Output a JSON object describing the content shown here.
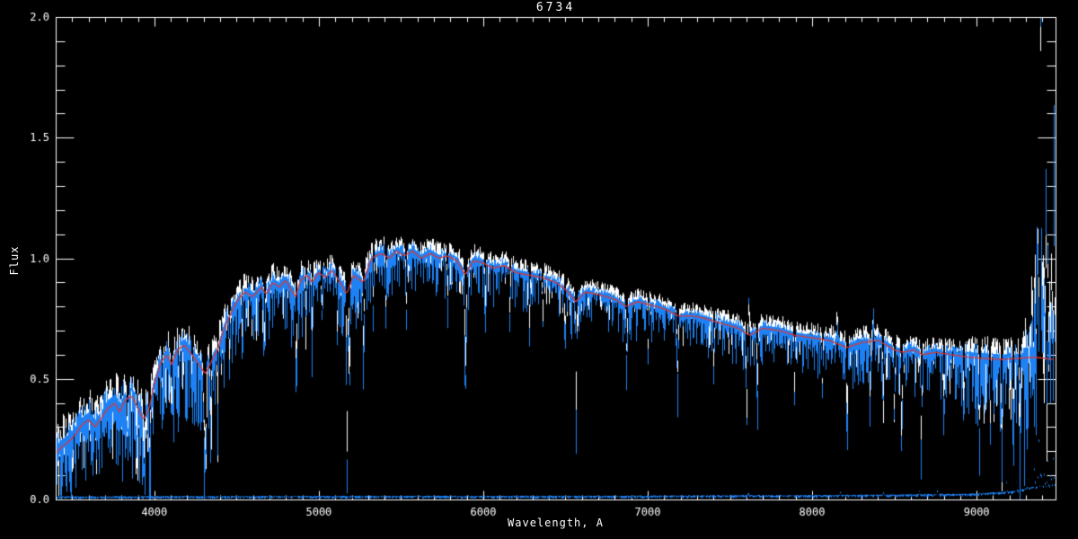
{
  "chart_data": {
    "type": "line",
    "title": "6734",
    "xlabel": "Wavelength, A",
    "ylabel": "Flux",
    "xlim": [
      3400,
      9480
    ],
    "ylim": [
      0.0,
      2.0
    ],
    "grid": false,
    "legend": null,
    "x_major_ticks": [
      4000,
      5000,
      6000,
      7000,
      8000,
      9000
    ],
    "x_tick_labels": [
      "4000",
      "5000",
      "6000",
      "7000",
      "8000",
      "9000"
    ],
    "x_minor_step": 100,
    "y_major_ticks": [
      0.0,
      0.5,
      1.0,
      1.5,
      2.0
    ],
    "y_tick_labels": [
      "0.0",
      "0.5",
      "1.0",
      "1.5",
      "2.0"
    ],
    "y_minor_step": 0.1,
    "colors": {
      "background": "#000000",
      "frame": "#ffffff",
      "observed": "#1e82f5",
      "overlay": "#ffffff",
      "model": "#d83838",
      "text": "#ffffff"
    },
    "noise_seed": 6734,
    "series": [
      {
        "name": "observed spectrum",
        "color_key": "observed",
        "style": "noisy line"
      },
      {
        "name": "overlay spectrum",
        "color_key": "overlay",
        "style": "noisy line behind observed"
      },
      {
        "name": "model continuum",
        "color_key": "model",
        "style": "smooth line"
      },
      {
        "name": "error spectrum",
        "color_key": "observed",
        "style": "flat line near zero"
      }
    ],
    "continuum_points": [
      [
        3400,
        0.19
      ],
      [
        3440,
        0.22
      ],
      [
        3480,
        0.24
      ],
      [
        3520,
        0.27
      ],
      [
        3560,
        0.31
      ],
      [
        3600,
        0.33
      ],
      [
        3640,
        0.3
      ],
      [
        3680,
        0.34
      ],
      [
        3720,
        0.38
      ],
      [
        3760,
        0.4
      ],
      [
        3790,
        0.36
      ],
      [
        3820,
        0.41
      ],
      [
        3860,
        0.43
      ],
      [
        3900,
        0.38
      ],
      [
        3935,
        0.33
      ],
      [
        3970,
        0.38
      ],
      [
        4000,
        0.48
      ],
      [
        4040,
        0.57
      ],
      [
        4080,
        0.6
      ],
      [
        4105,
        0.56
      ],
      [
        4140,
        0.62
      ],
      [
        4180,
        0.64
      ],
      [
        4230,
        0.6
      ],
      [
        4270,
        0.56
      ],
      [
        4310,
        0.52
      ],
      [
        4345,
        0.57
      ],
      [
        4390,
        0.63
      ],
      [
        4420,
        0.7
      ],
      [
        4470,
        0.78
      ],
      [
        4510,
        0.83
      ],
      [
        4550,
        0.86
      ],
      [
        4600,
        0.84
      ],
      [
        4650,
        0.88
      ],
      [
        4680,
        0.85
      ],
      [
        4720,
        0.9
      ],
      [
        4760,
        0.88
      ],
      [
        4800,
        0.91
      ],
      [
        4830,
        0.87
      ],
      [
        4860,
        0.84
      ],
      [
        4890,
        0.91
      ],
      [
        4930,
        0.93
      ],
      [
        4960,
        0.9
      ],
      [
        5000,
        0.94
      ],
      [
        5040,
        0.92
      ],
      [
        5080,
        0.95
      ],
      [
        5120,
        0.91
      ],
      [
        5170,
        0.85
      ],
      [
        5210,
        0.93
      ],
      [
        5270,
        0.9
      ],
      [
        5320,
        1.0
      ],
      [
        5380,
        1.02
      ],
      [
        5430,
        1.0
      ],
      [
        5470,
        1.03
      ],
      [
        5520,
        1.01
      ],
      [
        5570,
        1.03
      ],
      [
        5620,
        1.0
      ],
      [
        5680,
        1.02
      ],
      [
        5730,
        1.0
      ],
      [
        5780,
        1.01
      ],
      [
        5840,
        0.99
      ],
      [
        5890,
        0.93
      ],
      [
        5940,
        0.99
      ],
      [
        6000,
        0.98
      ],
      [
        6060,
        0.96
      ],
      [
        6130,
        0.97
      ],
      [
        6200,
        0.94
      ],
      [
        6280,
        0.93
      ],
      [
        6360,
        0.92
      ],
      [
        6440,
        0.9
      ],
      [
        6500,
        0.87
      ],
      [
        6563,
        0.82
      ],
      [
        6620,
        0.86
      ],
      [
        6700,
        0.85
      ],
      [
        6800,
        0.83
      ],
      [
        6870,
        0.8
      ],
      [
        6940,
        0.82
      ],
      [
        7000,
        0.81
      ],
      [
        7100,
        0.79
      ],
      [
        7190,
        0.76
      ],
      [
        7280,
        0.76
      ],
      [
        7350,
        0.75
      ],
      [
        7450,
        0.73
      ],
      [
        7550,
        0.71
      ],
      [
        7620,
        0.68
      ],
      [
        7700,
        0.71
      ],
      [
        7800,
        0.7
      ],
      [
        7900,
        0.68
      ],
      [
        8000,
        0.67
      ],
      [
        8100,
        0.66
      ],
      [
        8210,
        0.63
      ],
      [
        8300,
        0.65
      ],
      [
        8400,
        0.66
      ],
      [
        8500,
        0.62
      ],
      [
        8550,
        0.61
      ],
      [
        8620,
        0.62
      ],
      [
        8670,
        0.6
      ],
      [
        8750,
        0.61
      ],
      [
        8850,
        0.6
      ],
      [
        8950,
        0.59
      ],
      [
        9050,
        0.585
      ],
      [
        9150,
        0.58
      ],
      [
        9250,
        0.585
      ],
      [
        9350,
        0.59
      ],
      [
        9480,
        0.58
      ]
    ],
    "noise_profile": [
      [
        3400,
        3700,
        0.09,
        0.5,
        0.22
      ],
      [
        3700,
        4000,
        0.1,
        0.5,
        0.25
      ],
      [
        4000,
        4450,
        0.07,
        0.5,
        0.28
      ],
      [
        4450,
        5000,
        0.05,
        0.45,
        0.22
      ],
      [
        5000,
        5400,
        0.045,
        0.45,
        0.2
      ],
      [
        5400,
        6000,
        0.04,
        0.4,
        0.16
      ],
      [
        6000,
        6600,
        0.035,
        0.4,
        0.15
      ],
      [
        6600,
        7400,
        0.03,
        0.35,
        0.14
      ],
      [
        7400,
        8100,
        0.035,
        0.4,
        0.16
      ],
      [
        8100,
        8900,
        0.04,
        0.45,
        0.18
      ],
      [
        8900,
        9280,
        0.06,
        0.5,
        0.3
      ],
      [
        9280,
        9481,
        0.12,
        0.6,
        0.45
      ]
    ],
    "absorption_lines": [
      [
        3835,
        0.18,
        8
      ],
      [
        3890,
        0.2,
        8
      ],
      [
        3935,
        0.22,
        10
      ],
      [
        3970,
        0.22,
        8
      ],
      [
        4045,
        0.15,
        6
      ],
      [
        4102,
        0.25,
        8
      ],
      [
        4144,
        0.15,
        6
      ],
      [
        4227,
        0.18,
        6
      ],
      [
        4300,
        0.3,
        10
      ],
      [
        4310,
        0.42,
        6
      ],
      [
        4340,
        0.28,
        7
      ],
      [
        4383,
        0.25,
        6
      ],
      [
        4455,
        0.2,
        6
      ],
      [
        4530,
        0.22,
        6
      ],
      [
        4668,
        0.25,
        6
      ],
      [
        4861,
        0.35,
        7
      ],
      [
        4920,
        0.2,
        6
      ],
      [
        4957,
        0.22,
        6
      ],
      [
        5015,
        0.2,
        6
      ],
      [
        5110,
        0.25,
        6
      ],
      [
        5170,
        0.7,
        7
      ],
      [
        5185,
        0.42,
        6
      ],
      [
        5270,
        0.33,
        6
      ],
      [
        5330,
        0.25,
        6
      ],
      [
        5405,
        0.28,
        6
      ],
      [
        5530,
        0.25,
        6
      ],
      [
        5780,
        0.22,
        6
      ],
      [
        5890,
        0.44,
        9
      ],
      [
        6010,
        0.2,
        6
      ],
      [
        6160,
        0.22,
        6
      ],
      [
        6280,
        0.25,
        6
      ],
      [
        6360,
        0.2,
        6
      ],
      [
        6495,
        0.25,
        6
      ],
      [
        6563,
        0.46,
        7
      ],
      [
        6870,
        0.25,
        8
      ],
      [
        7000,
        0.22,
        6
      ],
      [
        7180,
        0.3,
        8
      ],
      [
        7400,
        0.22,
        6
      ],
      [
        7600,
        0.4,
        8
      ],
      [
        7665,
        0.28,
        7
      ],
      [
        7890,
        0.25,
        6
      ],
      [
        8060,
        0.25,
        6
      ],
      [
        8210,
        0.36,
        8
      ],
      [
        8350,
        0.25,
        6
      ],
      [
        8430,
        0.25,
        6
      ],
      [
        8498,
        0.33,
        7
      ],
      [
        8542,
        0.4,
        7
      ],
      [
        8662,
        0.4,
        7
      ],
      [
        8800,
        0.3,
        6
      ],
      [
        8920,
        0.3,
        6
      ],
      [
        9015,
        0.32,
        6
      ],
      [
        9080,
        0.35,
        6
      ],
      [
        9150,
        0.38,
        7
      ],
      [
        9220,
        0.35,
        6
      ],
      [
        9260,
        0.3,
        6
      ]
    ],
    "emission_spikes": [
      [
        7610,
        0.12,
        10
      ],
      [
        8150,
        0.12,
        6
      ],
      [
        8370,
        0.1,
        8
      ],
      [
        9335,
        0.4,
        4
      ],
      [
        9352,
        0.55,
        4
      ],
      [
        9368,
        1.15,
        4
      ],
      [
        9381,
        1.65,
        5
      ],
      [
        9386,
        1.55,
        4
      ],
      [
        9395,
        0.9,
        4
      ],
      [
        9406,
        0.6,
        4
      ],
      [
        9418,
        1.0,
        4
      ],
      [
        9432,
        0.55,
        4
      ],
      [
        9444,
        0.5,
        4
      ],
      [
        9455,
        0.65,
        4
      ],
      [
        9468,
        1.0,
        4
      ],
      [
        9478,
        0.8,
        4
      ]
    ],
    "error_points": [
      [
        3400,
        0.01
      ],
      [
        5000,
        0.012
      ],
      [
        6000,
        0.012
      ],
      [
        7000,
        0.013
      ],
      [
        7600,
        0.015
      ],
      [
        8000,
        0.015
      ],
      [
        8600,
        0.018
      ],
      [
        9000,
        0.022
      ],
      [
        9200,
        0.03
      ],
      [
        9350,
        0.05
      ],
      [
        9480,
        0.06
      ]
    ],
    "error_spikes": [
      [
        7610,
        0.02,
        5
      ],
      [
        8170,
        0.02,
        5
      ],
      [
        8430,
        0.02,
        5
      ],
      [
        8650,
        0.025,
        5
      ],
      [
        8760,
        0.02,
        5
      ],
      [
        9180,
        0.05,
        5
      ],
      [
        9240,
        0.04,
        5
      ],
      [
        9310,
        0.07,
        5
      ],
      [
        9350,
        0.12,
        5
      ],
      [
        9375,
        0.22,
        5
      ],
      [
        9390,
        0.1,
        5
      ],
      [
        9410,
        0.08,
        5
      ],
      [
        9430,
        0.12,
        5
      ],
      [
        9450,
        0.09,
        5
      ],
      [
        9465,
        0.14,
        5
      ]
    ]
  }
}
